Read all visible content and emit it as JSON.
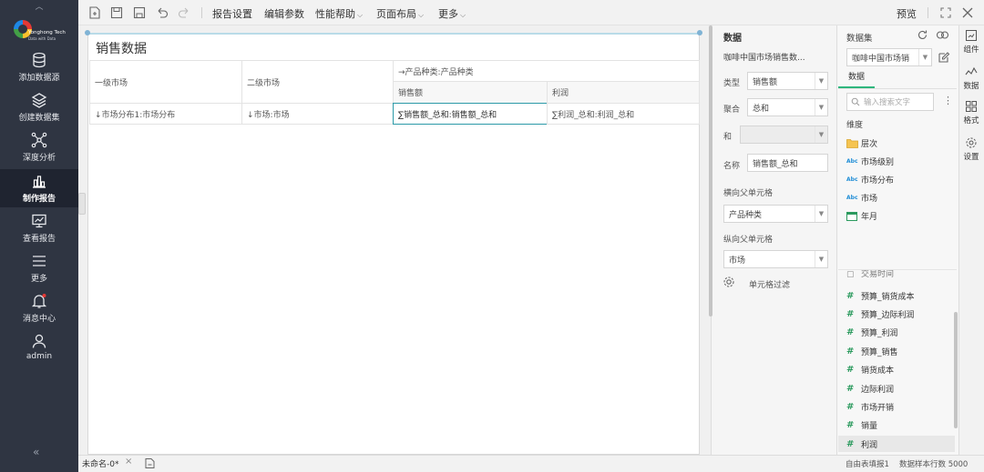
{
  "sidebar": {
    "brand": "Yonghong Tech",
    "tagline": "Data with Data",
    "items": [
      {
        "label": "添加数据源",
        "icon": "database-icon"
      },
      {
        "label": "创建数据集",
        "icon": "layers-icon"
      },
      {
        "label": "深度分析",
        "icon": "network-icon"
      },
      {
        "label": "制作报告",
        "icon": "bar-chart-icon",
        "active": true
      },
      {
        "label": "查看报告",
        "icon": "monitor-chart-icon"
      },
      {
        "label": "更多",
        "icon": "menu-icon"
      },
      {
        "label": "消息中心",
        "icon": "bell-icon"
      },
      {
        "label": "admin",
        "icon": "user-icon"
      }
    ],
    "collapse": "«"
  },
  "toolbar": {
    "menus": {
      "report_settings": "报告设置",
      "edit_params": "编辑参数",
      "perf_help": "性能帮助",
      "page_layout": "页面布局",
      "more": "更多"
    },
    "preview": "预览"
  },
  "report": {
    "title": "销售数据",
    "table": {
      "col_header_group": "→产品种类:产品种类",
      "row_hdr1": "一级市场",
      "row_hdr2": "二级市场",
      "col_sales": "销售额",
      "col_profit": "利润",
      "cell_r1": "↓市场分布1:市场分布",
      "cell_r2": "↓市场:市场",
      "cell_sales": "∑销售额_总和:销售额_总和",
      "cell_profit": "∑利润_总和:利润_总和"
    }
  },
  "props": {
    "title": "数据",
    "dataset_name": "咖啡中国市场销售数...",
    "type_label": "类型",
    "type_value": "销售额",
    "agg_label": "聚合",
    "agg_value": "总和",
    "and_label": "和",
    "and_value": "",
    "name_label": "名称",
    "name_value": "销售额_总和",
    "h_parent_label": "横向父单元格",
    "h_parent_value": "产品种类",
    "v_parent_label": "纵向父单元格",
    "v_parent_value": "市场",
    "cell_filter": "单元格过滤"
  },
  "dataset": {
    "title": "数据集",
    "selected": "咖啡中国市场销",
    "tab": "数据",
    "search_placeholder": "输入搜索文字",
    "dims_title": "维度",
    "dims": [
      {
        "label": "层次",
        "icon": "folder-icon"
      },
      {
        "label": "市场级别",
        "icon": "abc-icon"
      },
      {
        "label": "市场分布",
        "icon": "abc-icon"
      },
      {
        "label": "市场",
        "icon": "abc-icon"
      },
      {
        "label": "年月",
        "icon": "calendar-icon"
      }
    ],
    "partial": "交易时间",
    "measures": [
      {
        "label": "预算_销货成本"
      },
      {
        "label": "预算_边际利润"
      },
      {
        "label": "预算_利润"
      },
      {
        "label": "预算_销售"
      },
      {
        "label": "销货成本"
      },
      {
        "label": "边际利润"
      },
      {
        "label": "市场开销"
      },
      {
        "label": "销量"
      },
      {
        "label": "利润",
        "selected": true
      }
    ]
  },
  "strip": {
    "components": "组件",
    "data": "数据",
    "format": "格式",
    "settings": "设置"
  },
  "status": {
    "tab": "未命名-0*",
    "mode": "自由表填报1",
    "sample": "数据样本行数 5000"
  }
}
